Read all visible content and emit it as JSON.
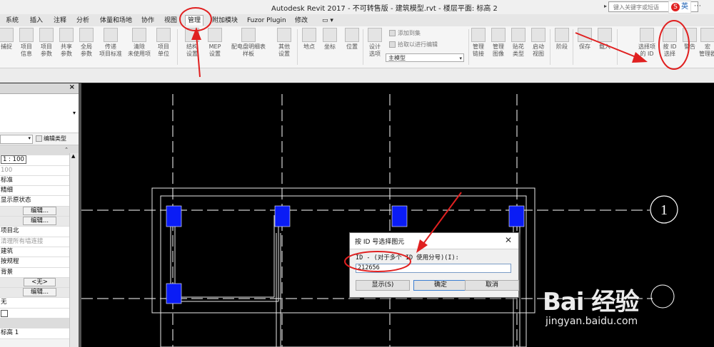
{
  "titlebar": {
    "title": "Autodesk Revit 2017 - 不可转售版 -    建筑模型.rvt - 楼层平面: 标高 2",
    "search_placeholder": "键入关键字或短语",
    "ime_label": "英"
  },
  "tabs": [
    "系统",
    "插入",
    "注释",
    "分析",
    "体量和场地",
    "协作",
    "视图",
    "管理",
    "附加模块",
    "Fuzor Plugin",
    "修改"
  ],
  "active_tab": "管理",
  "ribbon": {
    "buttons": [
      {
        "l1": "捕捉",
        "l2": ""
      },
      {
        "l1": "项目",
        "l2": "信息"
      },
      {
        "l1": "项目",
        "l2": "参数"
      },
      {
        "l1": "共享",
        "l2": "参数"
      },
      {
        "l1": "全局",
        "l2": "参数"
      },
      {
        "l1": "传递",
        "l2": "项目标准"
      },
      {
        "l1": "清除",
        "l2": "未使用项"
      },
      {
        "l1": "项目",
        "l2": "单位"
      },
      {
        "l1": "结构",
        "l2": "设置"
      },
      {
        "l1": "MEP",
        "l2": "设置"
      },
      {
        "l1": "配电盘明细表",
        "l2": "样板"
      },
      {
        "l1": "其他",
        "l2": "设置"
      },
      {
        "l1": "地点",
        "l2": ""
      },
      {
        "l1": "坐标",
        "l2": ""
      },
      {
        "l1": "位置",
        "l2": ""
      },
      {
        "l1": "设计",
        "l2": "选项"
      },
      {
        "l1": "管理",
        "l2": "链接"
      },
      {
        "l1": "管理",
        "l2": "图像"
      },
      {
        "l1": "贴花",
        "l2": "类型"
      },
      {
        "l1": "启动",
        "l2": "视图"
      },
      {
        "l1": "阶段",
        "l2": ""
      },
      {
        "l1": "保存",
        "l2": ""
      },
      {
        "l1": "载入",
        "l2": ""
      },
      {
        "l1": "选择项",
        "l2": "的 ID"
      },
      {
        "l1": "按 ID",
        "l2": "选择"
      },
      {
        "l1": "警告",
        "l2": ""
      },
      {
        "l1": "宏",
        "l2": "管理器"
      }
    ],
    "add_to_set": "添加到集",
    "pick_to_edit": "拾取以进行编辑",
    "main_model": "主模型"
  },
  "properties": {
    "edit_type": "编辑类型",
    "rows": [
      {
        "text": "1 : 100",
        "style": "boxed"
      },
      {
        "text": "100",
        "style": "grey"
      },
      {
        "text": "标准",
        "style": ""
      },
      {
        "text": "精细",
        "style": ""
      },
      {
        "text": "显示原状态",
        "style": ""
      },
      {
        "text": "编辑...",
        "style": "btn"
      },
      {
        "text": "编辑...",
        "style": "btn"
      },
      {
        "text": "项目北",
        "style": ""
      },
      {
        "text": "清理所有墙连接",
        "style": "grey"
      },
      {
        "text": "建筑",
        "style": ""
      },
      {
        "text": "按规程",
        "style": ""
      },
      {
        "text": "背景",
        "style": ""
      },
      {
        "text": "<无>",
        "style": "btn"
      },
      {
        "text": "编辑...",
        "style": "btn"
      },
      {
        "text": "无",
        "style": ""
      },
      {
        "text": "",
        "style": "check"
      },
      {
        "text": "",
        "style": "section"
      },
      {
        "text": "标高 1",
        "style": ""
      }
    ]
  },
  "drawing": {
    "grid_bubble_1": "1"
  },
  "dialog": {
    "title": "按 ID 号选择图元",
    "label": "ID - (对于多个 ID 使用分号)(I):",
    "value": "212656",
    "show_button": "显示(S)",
    "ok_button": "确定",
    "cancel_button": "取消"
  },
  "watermark": {
    "big": "Bai 经验",
    "small": "jingyan.baidu.com"
  },
  "colors": {
    "annotation_red": "#e02020",
    "column_blue": "#0a1cf5",
    "canvas_bg": "#000000"
  }
}
